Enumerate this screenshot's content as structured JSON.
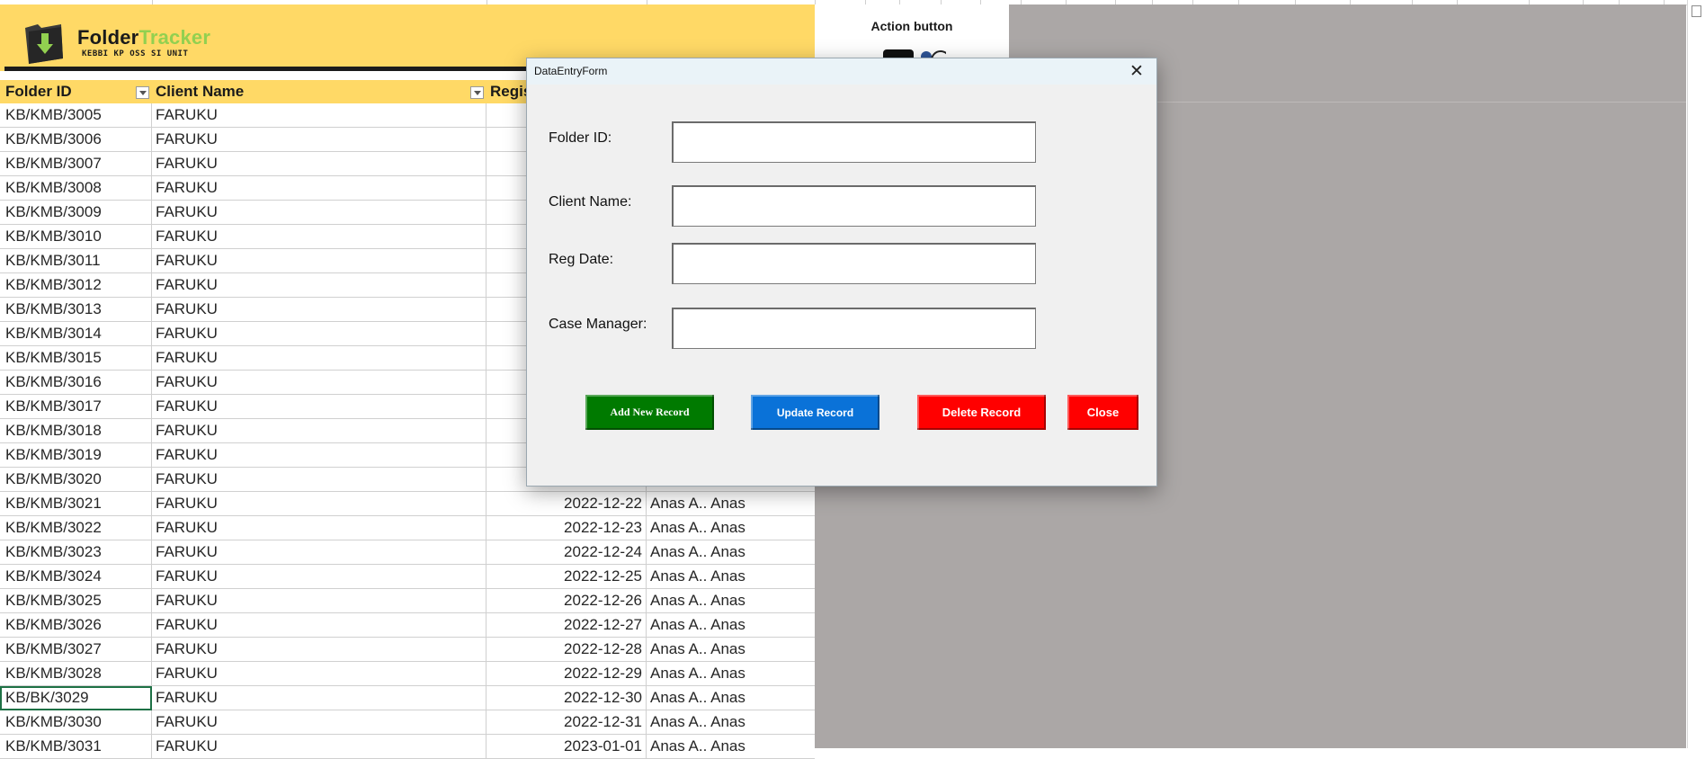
{
  "banner": {
    "title_main": "Folder",
    "title_accent": "Tracker",
    "subtitle": "KEBBI KP OSS SI UNIT"
  },
  "action_panel": {
    "title": "Action button"
  },
  "table": {
    "headers": [
      "Folder ID",
      "Client Name",
      "Regis"
    ],
    "rows": [
      {
        "id": "KB/KMB/3005",
        "name": "FARUKU",
        "date": "",
        "manager": ""
      },
      {
        "id": "KB/KMB/3006",
        "name": "FARUKU",
        "date": "",
        "manager": ""
      },
      {
        "id": "KB/KMB/3007",
        "name": "FARUKU",
        "date": "",
        "manager": ""
      },
      {
        "id": "KB/KMB/3008",
        "name": "FARUKU",
        "date": "",
        "manager": ""
      },
      {
        "id": "KB/KMB/3009",
        "name": "FARUKU",
        "date": "",
        "manager": ""
      },
      {
        "id": "KB/KMB/3010",
        "name": "FARUKU",
        "date": "",
        "manager": ""
      },
      {
        "id": "KB/KMB/3011",
        "name": "FARUKU",
        "date": "",
        "manager": ""
      },
      {
        "id": "KB/KMB/3012",
        "name": "FARUKU",
        "date": "",
        "manager": ""
      },
      {
        "id": "KB/KMB/3013",
        "name": "FARUKU",
        "date": "",
        "manager": ""
      },
      {
        "id": "KB/KMB/3014",
        "name": "FARUKU",
        "date": "",
        "manager": ""
      },
      {
        "id": "KB/KMB/3015",
        "name": "FARUKU",
        "date": "",
        "manager": ""
      },
      {
        "id": "KB/KMB/3016",
        "name": "FARUKU",
        "date": "",
        "manager": ""
      },
      {
        "id": "KB/KMB/3017",
        "name": "FARUKU",
        "date": "",
        "manager": ""
      },
      {
        "id": "KB/KMB/3018",
        "name": "FARUKU",
        "date": "",
        "manager": ""
      },
      {
        "id": "KB/KMB/3019",
        "name": "FARUKU",
        "date": "",
        "manager": ""
      },
      {
        "id": "KB/KMB/3020",
        "name": "FARUKU",
        "date": "",
        "manager": ""
      },
      {
        "id": "KB/KMB/3021",
        "name": "FARUKU",
        "date": "2022-12-22",
        "manager": "Anas A.. Anas"
      },
      {
        "id": "KB/KMB/3022",
        "name": "FARUKU",
        "date": "2022-12-23",
        "manager": "Anas A.. Anas"
      },
      {
        "id": "KB/KMB/3023",
        "name": "FARUKU",
        "date": "2022-12-24",
        "manager": "Anas A.. Anas"
      },
      {
        "id": "KB/KMB/3024",
        "name": "FARUKU",
        "date": "2022-12-25",
        "manager": "Anas A.. Anas"
      },
      {
        "id": "KB/KMB/3025",
        "name": "FARUKU",
        "date": "2022-12-26",
        "manager": "Anas A.. Anas"
      },
      {
        "id": "KB/KMB/3026",
        "name": "FARUKU",
        "date": "2022-12-27",
        "manager": "Anas A.. Anas"
      },
      {
        "id": "KB/KMB/3027",
        "name": "FARUKU",
        "date": "2022-12-28",
        "manager": "Anas A.. Anas"
      },
      {
        "id": "KB/KMB/3028",
        "name": "FARUKU",
        "date": "2022-12-29",
        "manager": "Anas A.. Anas"
      },
      {
        "id": "KB/BK/3029",
        "name": "FARUKU",
        "date": "2022-12-30",
        "manager": "Anas A.. Anas",
        "selected": true
      },
      {
        "id": "KB/KMB/3030",
        "name": "FARUKU",
        "date": "2022-12-31",
        "manager": "Anas A.. Anas"
      },
      {
        "id": "KB/KMB/3031",
        "name": "FARUKU",
        "date": "2023-01-01",
        "manager": "Anas A.. Anas"
      }
    ]
  },
  "dialog": {
    "title": "DataEntryForm",
    "close_glyph": "✕",
    "labels": {
      "folder_id": "Folder ID:",
      "client_name": "Client Name:",
      "reg_date": "Reg Date:",
      "case_manager": "Case Manager:"
    },
    "values": {
      "folder_id": "",
      "client_name": "",
      "reg_date": "",
      "case_manager": ""
    },
    "buttons": {
      "add": "Add New Record",
      "update": "Update Record",
      "delete": "Delete Record",
      "close": "Close"
    }
  },
  "colors": {
    "banner": "#ffd966",
    "accent": "#92d050",
    "add_button": "#007a00",
    "update_button": "#0a72d8",
    "delete_button": "#ff0000",
    "selection": "#1e7145"
  }
}
